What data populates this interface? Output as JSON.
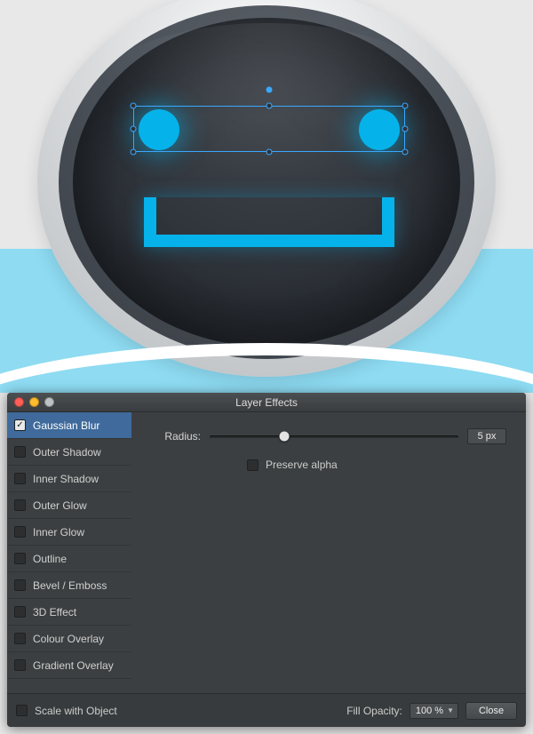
{
  "dialog": {
    "title": "Layer Effects"
  },
  "effects": {
    "items": [
      {
        "label": "Gaussian Blur",
        "checked": true
      },
      {
        "label": "Outer Shadow",
        "checked": false
      },
      {
        "label": "Inner Shadow",
        "checked": false
      },
      {
        "label": "Outer Glow",
        "checked": false
      },
      {
        "label": "Inner Glow",
        "checked": false
      },
      {
        "label": "Outline",
        "checked": false
      },
      {
        "label": "Bevel / Emboss",
        "checked": false
      },
      {
        "label": "3D Effect",
        "checked": false
      },
      {
        "label": "Colour Overlay",
        "checked": false
      },
      {
        "label": "Gradient Overlay",
        "checked": false
      }
    ],
    "selected_index": 0
  },
  "gaussian_blur": {
    "radius_label": "Radius:",
    "radius_value": "5 px",
    "radius_fraction": 0.3,
    "preserve_alpha_label": "Preserve alpha",
    "preserve_alpha_checked": false
  },
  "footer": {
    "scale_label": "Scale with Object",
    "scale_checked": false,
    "fill_opacity_label": "Fill Opacity:",
    "fill_opacity_value": "100 %",
    "close_label": "Close"
  }
}
